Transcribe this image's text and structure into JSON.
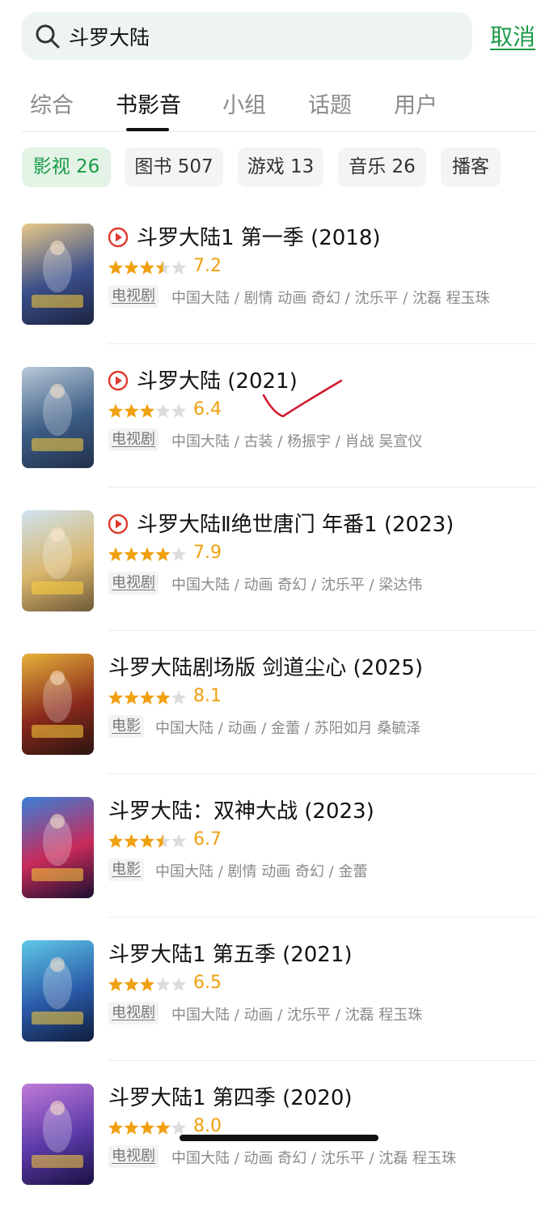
{
  "search": {
    "query": "斗罗大陆",
    "cancel_label": "取消"
  },
  "tabs": [
    "综合",
    "书影音",
    "小组",
    "话题",
    "用户"
  ],
  "active_tab": "书影音",
  "chips": [
    {
      "label": "影视 26",
      "active": true
    },
    {
      "label": "图书 507",
      "active": false
    },
    {
      "label": "游戏 13",
      "active": false
    },
    {
      "label": "音乐 26",
      "active": false
    },
    {
      "label": "播客",
      "active": false
    }
  ],
  "results": [
    {
      "title": "斗罗大陆1 第一季 (2018)",
      "has_play": true,
      "rating": "7.2",
      "stars": 3.5,
      "type": "电视剧",
      "meta": "中国大陆 / 剧情 动画 奇幻 / 沈乐平 / 沈磊 程玉珠",
      "poster_colors": [
        "#e8c98a",
        "#3a4f8a",
        "#1c2340"
      ]
    },
    {
      "title": "斗罗大陆 (2021)",
      "has_play": true,
      "rating": "6.4",
      "stars": 3,
      "type": "电视剧",
      "meta": "中国大陆 / 古装 / 杨振宇 / 肖战 吴宣仪",
      "poster_colors": [
        "#b9c9d8",
        "#3b5c84",
        "#222f4a"
      ]
    },
    {
      "title": "斗罗大陆Ⅱ绝世唐门 年番1 (2023)",
      "has_play": true,
      "rating": "7.9",
      "stars": 4,
      "type": "电视剧",
      "meta": "中国大陆 / 动画 奇幻 / 沈乐平 / 梁达伟",
      "poster_colors": [
        "#cfe3f0",
        "#d8b56a",
        "#6f5a3a"
      ]
    },
    {
      "title": "斗罗大陆剧场版 剑道尘心 (2025)",
      "has_play": false,
      "rating": "8.1",
      "stars": 4,
      "type": "电影",
      "meta": "中国大陆 / 动画 / 金蕾 / 苏阳如月 桑毓泽",
      "poster_colors": [
        "#e6b23a",
        "#8a2a1c",
        "#2a1410"
      ]
    },
    {
      "title": "斗罗大陆：双神大战 (2023)",
      "has_play": false,
      "rating": "6.7",
      "stars": 3.5,
      "type": "电影",
      "meta": "中国大陆 / 剧情 动画 奇幻 / 金蕾",
      "poster_colors": [
        "#3a7fd8",
        "#c82a5a",
        "#1a1030"
      ]
    },
    {
      "title": "斗罗大陆1 第五季 (2021)",
      "has_play": false,
      "rating": "6.5",
      "stars": 3,
      "type": "电视剧",
      "meta": "中国大陆 / 动画 / 沈乐平 / 沈磊 程玉珠",
      "poster_colors": [
        "#5fc8e8",
        "#2a5aa8",
        "#101c3a"
      ]
    },
    {
      "title": "斗罗大陆1 第四季 (2020)",
      "has_play": false,
      "rating": "8.0",
      "stars": 4,
      "type": "电视剧",
      "meta": "中国大陆 / 动画 奇幻 / 沈乐平 / 沈磊 程玉珠",
      "poster_colors": [
        "#c07ad8",
        "#5a3aa8",
        "#1a1040"
      ]
    }
  ],
  "colors": {
    "accent_green": "#1a9a46",
    "star": "#f0a010",
    "play_red": "#e03a2e",
    "annotation_red": "#d0162a"
  }
}
